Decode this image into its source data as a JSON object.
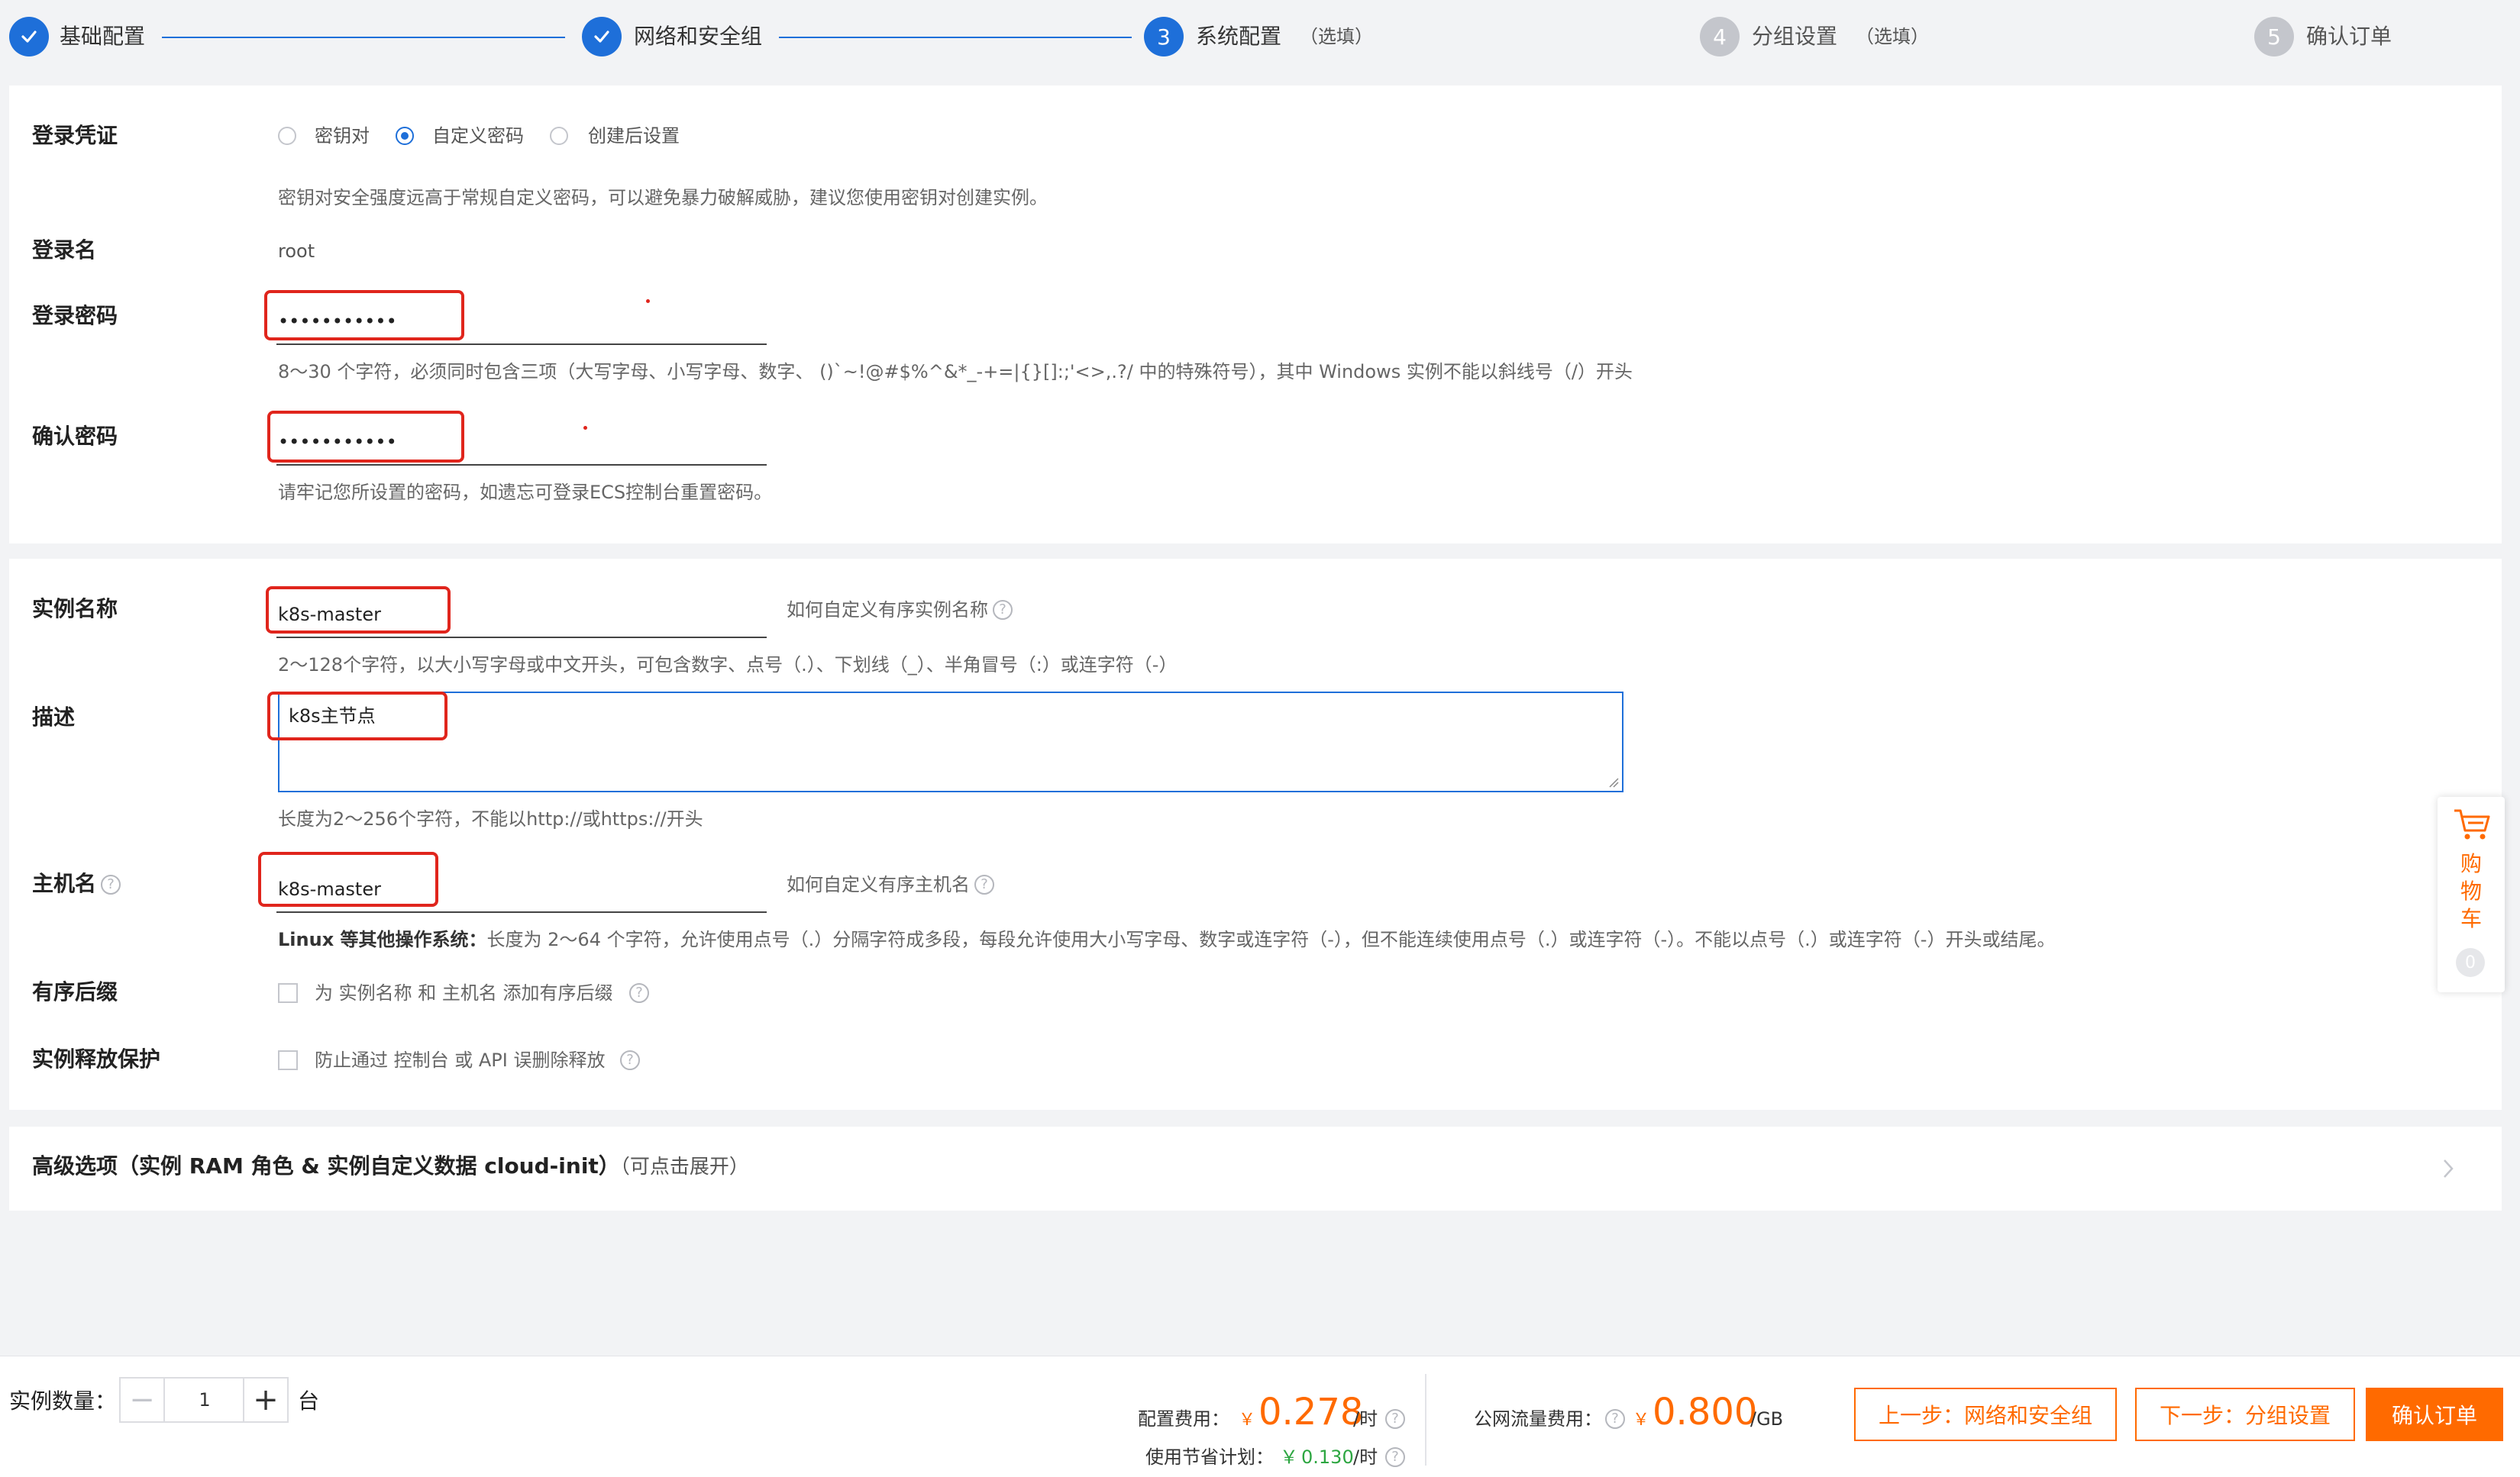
{
  "stepper": {
    "steps": [
      {
        "number": "1",
        "label": "基础配置",
        "optional": "",
        "state": "done"
      },
      {
        "number": "2",
        "label": "网络和安全组",
        "optional": "",
        "state": "done"
      },
      {
        "number": "3",
        "label": "系统配置",
        "optional": "（选填）",
        "state": "active"
      },
      {
        "number": "4",
        "label": "分组设置",
        "optional": "（选填）",
        "state": "todo"
      },
      {
        "number": "5",
        "label": "确认订单",
        "optional": "",
        "state": "todo"
      }
    ]
  },
  "credentials": {
    "label": "登录凭证",
    "options": [
      "密钥对",
      "自定义密码",
      "创建后设置"
    ],
    "selected": "自定义密码",
    "hint": "密钥对安全强度远高于常规自定义密码，可以避免暴力破解威胁，建议您使用密钥对创建实例。"
  },
  "login_name": {
    "label": "登录名",
    "value": "root"
  },
  "password": {
    "label": "登录密码",
    "value": "•••••••••••",
    "hint": "8～30 个字符，必须同时包含三项（大写字母、小写字母、数字、 ()`~!@#$%^&*_-+=|{}[]:;'<>,.?/ 中的特殊符号），其中 Windows 实例不能以斜线号（/）开头"
  },
  "confirm_password": {
    "label": "确认密码",
    "value": "•••••••••••",
    "hint": "请牢记您所设置的密码，如遗忘可登录ECS控制台重置密码。"
  },
  "instance_name": {
    "label": "实例名称",
    "value": "k8s-master",
    "link": "如何自定义有序实例名称",
    "hint": "2～128个字符，以大小写字母或中文开头，可包含数字、点号（.）、下划线（_）、半角冒号（:）或连字符（-）"
  },
  "description": {
    "label": "描述",
    "value": "k8s主节点",
    "hint": "长度为2～256个字符，不能以http://或https://开头"
  },
  "hostname": {
    "label": "主机名",
    "value": "k8s-master",
    "link": "如何自定义有序主机名",
    "hint_bold": "Linux 等其他操作系统：",
    "hint": "长度为 2～64 个字符，允许使用点号（.）分隔字符成多段，每段允许使用大小写字母、数字或连字符（-），但不能连续使用点号（.）或连字符（-）。不能以点号（.）或连字符（-）开头或结尾。"
  },
  "ordered_suffix": {
    "label": "有序后缀",
    "checkbox_text": "为 实例名称 和 主机名 添加有序后缀"
  },
  "release_protection": {
    "label": "实例释放保护",
    "checkbox_text": "防止通过 控制台 或 API 误删除释放"
  },
  "advanced": {
    "label": "高级选项（实例 RAM 角色 & 实例自定义数据 cloud-init）",
    "hint": "（可点击展开）"
  },
  "cart": {
    "label_chars": [
      "购",
      "物",
      "车"
    ],
    "count": "0"
  },
  "footer": {
    "qty_label": "实例数量：",
    "qty_value": "1",
    "qty_unit": "台",
    "config_fee_label": "配置费用：",
    "config_fee_symbol": "￥",
    "config_fee_value": "0.278",
    "config_fee_unit": "/时",
    "savings_label": "使用节省计划：",
    "savings_symbol": "￥",
    "savings_value": "0.130",
    "savings_unit": "/时",
    "traffic_fee_label": "公网流量费用：",
    "traffic_fee_symbol": "￥",
    "traffic_fee_value": "0.800",
    "traffic_fee_unit": "/GB",
    "prev_button": "上一步：网络和安全组",
    "next_button": "下一步：分组设置",
    "confirm_button": "确认订单"
  },
  "colors": {
    "primary": "#1e6fd9",
    "accent": "#ff6a00",
    "annotation": "#e0251c",
    "savings": "#2da641"
  }
}
